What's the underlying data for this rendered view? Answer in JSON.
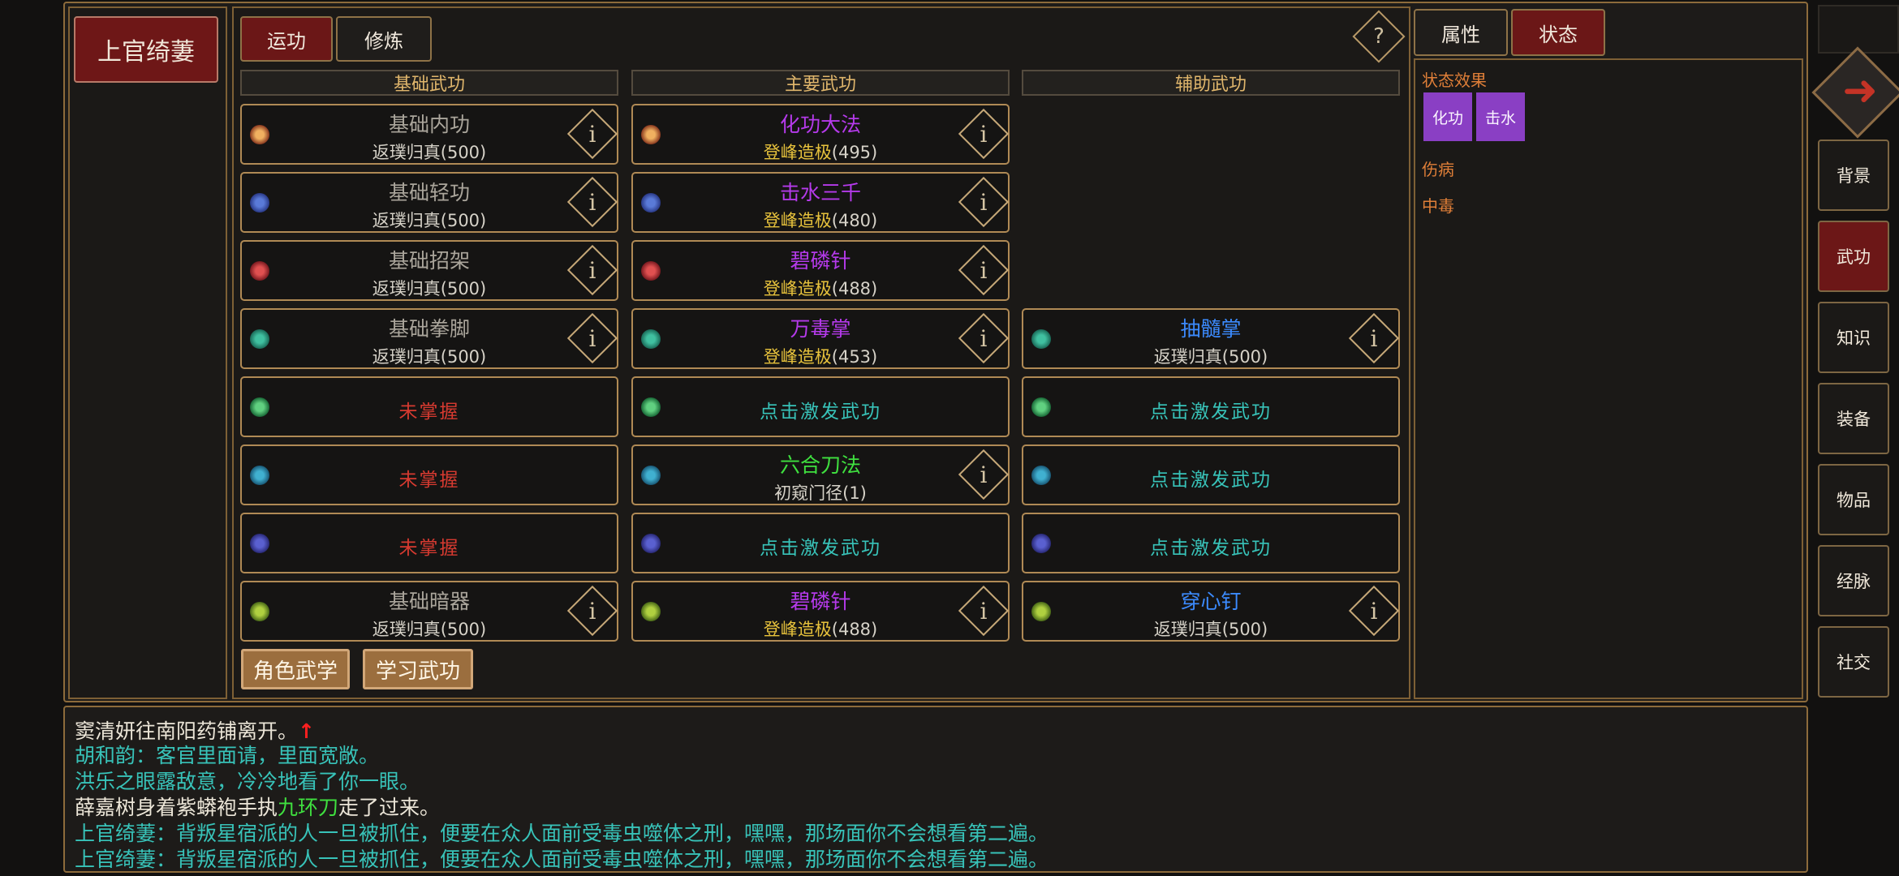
{
  "character_name": "上官绮萋",
  "tabs": {
    "active": "运功",
    "second": "修炼"
  },
  "help_symbol": "?",
  "columns": {
    "basic": "基础武功",
    "main": "主要武功",
    "aux": "辅助武功"
  },
  "info_symbol": "i",
  "skills": {
    "basic": [
      {
        "name": "基础内功",
        "level": "返璞归真",
        "value": "(500)"
      },
      {
        "name": "基础轻功",
        "level": "返璞归真",
        "value": "(500)"
      },
      {
        "name": "基础招架",
        "level": "返璞归真",
        "value": "(500)"
      },
      {
        "name": "基础拳脚",
        "level": "返璞归真",
        "value": "(500)"
      },
      {
        "empty": "未掌握"
      },
      {
        "empty": "未掌握"
      },
      {
        "empty": "未掌握"
      },
      {
        "name": "基础暗器",
        "level": "返璞归真",
        "value": "(500)"
      }
    ],
    "main": [
      {
        "name": "化功大法",
        "level": "登峰造极",
        "value": "(495)"
      },
      {
        "name": "击水三千",
        "level": "登峰造极",
        "value": "(480)"
      },
      {
        "name": "碧磷针",
        "level": "登峰造极",
        "value": "(488)"
      },
      {
        "name": "万毒掌",
        "level": "登峰造极",
        "value": "(453)"
      },
      {
        "empty": "点击激发武功"
      },
      {
        "name": "六合刀法",
        "level": "初窥门径",
        "value": "(1)"
      },
      {
        "empty": "点击激发武功"
      },
      {
        "name": "碧磷针",
        "level": "登峰造极",
        "value": "(488)"
      }
    ],
    "aux": [
      {
        "name": "抽髓掌",
        "level": "返璞归真",
        "value": "(500)"
      },
      {
        "empty": "点击激发武功"
      },
      {
        "empty": "点击激发武功"
      },
      {
        "empty": "点击激发武功"
      },
      {
        "name": "穿心钉",
        "level": "返璞归真",
        "value": "(500)"
      }
    ]
  },
  "bottom_buttons": {
    "role_skills": "角色武学",
    "learn_skills": "学习武功"
  },
  "right_panel": {
    "tab_attr": "属性",
    "tab_status": "状态",
    "status_effects_title": "状态效果",
    "effects": [
      "化功",
      "击水"
    ],
    "injury": "伤病",
    "poison": "中毒"
  },
  "side_menu": [
    "背景",
    "武功",
    "知识",
    "装备",
    "物品",
    "经脉",
    "社交"
  ],
  "log": {
    "line1": "窦清妍往南阳药铺离开。",
    "line2": "胡和韵：客官里面请，里面宽敞。",
    "line3": "洪乐之眼露敌意，冷冷地看了你一眼。",
    "line4_a": "薛嘉树身着紫蟒袍手执",
    "line4_b": "九环刀",
    "line4_c": "走了过来。",
    "line5": "上官绮萋：背叛星宿派的人一旦被抓住，便要在众人面前受毒虫噬体之刑，嘿嘿，那场面你不会想看第二遍。",
    "line6": "上官绮萋：背叛星宿派的人一旦被抓住，便要在众人面前受毒虫噬体之刑，嘿嘿，那场面你不会想看第二遍。"
  }
}
